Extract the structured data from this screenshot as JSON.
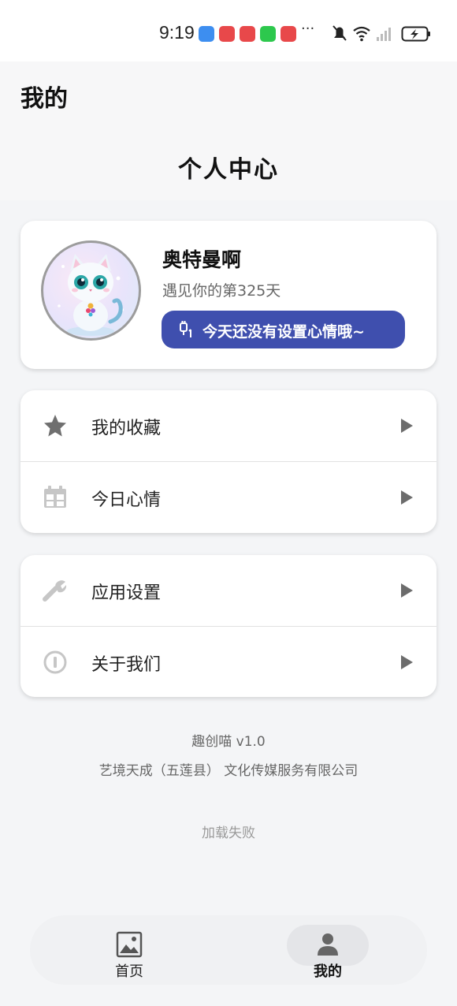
{
  "status_bar": {
    "time": "9:19",
    "more": "···"
  },
  "header": {
    "title": "我的",
    "page_title": "个人中心"
  },
  "profile": {
    "username": "奥特曼啊",
    "days_text": "遇见你的第325天",
    "mood_button": "今天还没有设置心情哦~"
  },
  "menu": {
    "group1": [
      {
        "label": "我的收藏",
        "icon": "star-icon"
      },
      {
        "label": "今日心情",
        "icon": "calendar-icon"
      }
    ],
    "group2": [
      {
        "label": "应用设置",
        "icon": "wrench-icon"
      },
      {
        "label": "关于我们",
        "icon": "info-icon"
      }
    ]
  },
  "footer": {
    "app_version": "趣创喵 v1.0",
    "company": "艺境天成（五莲县） 文化传媒服务有限公司",
    "load_status": "加载失败"
  },
  "nav": {
    "home": "首页",
    "mine": "我的",
    "active": "mine"
  },
  "colors": {
    "accent": "#3f4fae",
    "background": "#f4f5f7",
    "card": "#ffffff"
  }
}
